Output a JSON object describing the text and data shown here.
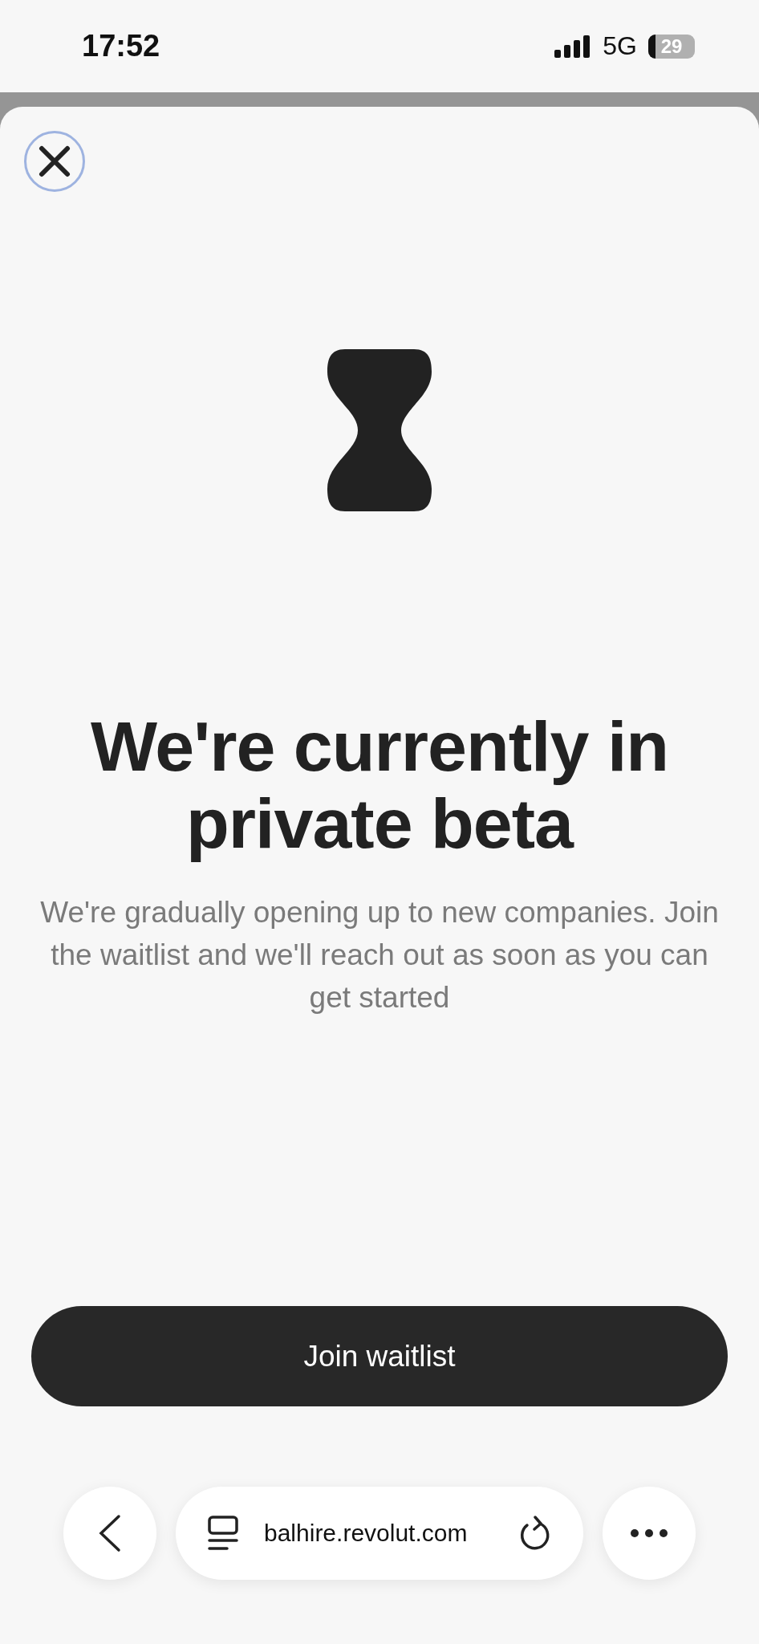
{
  "status_bar": {
    "time": "17:52",
    "network": "5G",
    "battery": "29"
  },
  "sheet": {
    "title": "We're currently in private beta",
    "subtitle": "We're gradually opening up to new companies. Join the waitlist and we'll reach out as soon as you can get started",
    "button": "Join waitlist"
  },
  "browser_bar": {
    "url": "balhire.revolut.com"
  }
}
